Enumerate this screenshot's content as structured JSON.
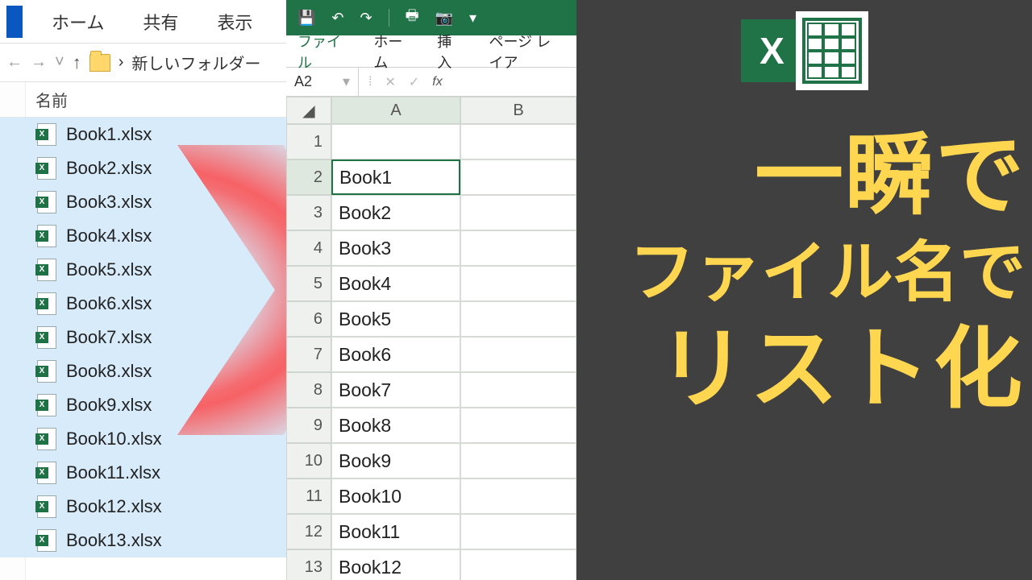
{
  "explorer": {
    "ribbon_tabs": [
      "ホーム",
      "共有",
      "表示"
    ],
    "breadcrumb_sep": "›",
    "breadcrumb_folder": "新しいフォルダー",
    "name_column": "名前",
    "files": [
      {
        "name": "Book1.xlsx"
      },
      {
        "name": "Book2.xlsx"
      },
      {
        "name": "Book3.xlsx"
      },
      {
        "name": "Book4.xlsx"
      },
      {
        "name": "Book5.xlsx"
      },
      {
        "name": "Book6.xlsx"
      },
      {
        "name": "Book7.xlsx"
      },
      {
        "name": "Book8.xlsx"
      },
      {
        "name": "Book9.xlsx"
      },
      {
        "name": "Book10.xlsx"
      },
      {
        "name": "Book11.xlsx"
      },
      {
        "name": "Book12.xlsx"
      },
      {
        "name": "Book13.xlsx"
      }
    ]
  },
  "excel": {
    "ribbon_tabs": {
      "file": "ファイル",
      "home": "ホーム",
      "insert": "挿入",
      "page": "ページ レイア"
    },
    "name_box": "A2",
    "fx_label": "fx",
    "columns": [
      "A",
      "B"
    ],
    "rows": [
      {
        "n": 1,
        "a": ""
      },
      {
        "n": 2,
        "a": "Book1"
      },
      {
        "n": 3,
        "a": "Book2"
      },
      {
        "n": 4,
        "a": "Book3"
      },
      {
        "n": 5,
        "a": "Book4"
      },
      {
        "n": 6,
        "a": "Book5"
      },
      {
        "n": 7,
        "a": "Book6"
      },
      {
        "n": 8,
        "a": "Book7"
      },
      {
        "n": 9,
        "a": "Book8"
      },
      {
        "n": 10,
        "a": "Book9"
      },
      {
        "n": 11,
        "a": "Book10"
      },
      {
        "n": 12,
        "a": "Book11"
      },
      {
        "n": 13,
        "a": "Book12"
      }
    ],
    "selected_cell": "A2"
  },
  "promo": {
    "logo_letter": "X",
    "line1": "一瞬で",
    "line2": "ファイル名で",
    "line3": "リスト化"
  }
}
